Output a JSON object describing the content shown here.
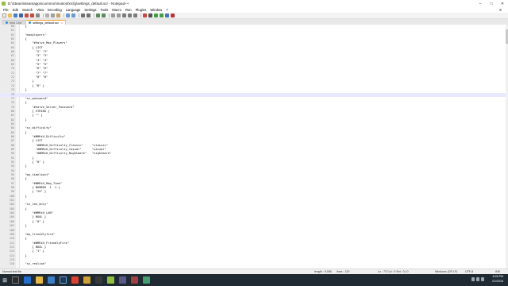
{
  "window": {
    "title": "D:\\Steam\\steamapps\\common\\motionfx\\cfg\\settings_default.scr - Notepad++",
    "minimize": "–",
    "maximize": "□",
    "close": "✕"
  },
  "menu": [
    "File",
    "Edit",
    "Search",
    "View",
    "Encoding",
    "Language",
    "Settings",
    "Tools",
    "Macro",
    "Run",
    "Plugins",
    "Window",
    "?"
  ],
  "menu_close": "X",
  "tabs": [
    {
      "label": "new 1.txt",
      "active": false
    },
    {
      "label": "settings_default.scr",
      "active": true
    }
  ],
  "editor": {
    "current_line": 76,
    "lines": [
      {
        "n": 60,
        "text": "  }"
      },
      {
        "n": 61,
        "text": ""
      },
      {
        "n": 62,
        "text": "  \"maxplayers\""
      },
      {
        "n": 63,
        "text": "  {"
      },
      {
        "n": 64,
        "text": "      \"#Valve_Max_Players\""
      },
      {
        "n": 65,
        "text": "      { LIST"
      },
      {
        "n": 66,
        "text": "        \"2\" \"2\""
      },
      {
        "n": 67,
        "text": "        \"3\" \"3\""
      },
      {
        "n": 68,
        "text": "        \"4\" \"4\""
      },
      {
        "n": 69,
        "text": "        \"5\" \"5\""
      },
      {
        "n": 70,
        "text": "        \"6\" \"6\""
      },
      {
        "n": 71,
        "text": "        \"7\" \"7\""
      },
      {
        "n": 72,
        "text": "        \"8\" \"8\""
      },
      {
        "n": 73,
        "text": "      }"
      },
      {
        "n": 74,
        "text": "      { \"8\" }"
      },
      {
        "n": 75,
        "text": "  }"
      },
      {
        "n": 76,
        "text": ""
      },
      {
        "n": 77,
        "text": "  \"sv_password\""
      },
      {
        "n": 78,
        "text": "  {"
      },
      {
        "n": 79,
        "text": "      \"#Valve_Server_Password\""
      },
      {
        "n": 80,
        "text": "      { STRING }"
      },
      {
        "n": 81,
        "text": "      { \"\" }"
      },
      {
        "n": 82,
        "text": "  }"
      },
      {
        "n": 83,
        "text": ""
      },
      {
        "n": 84,
        "text": "  \"sv_difficulty\""
      },
      {
        "n": 85,
        "text": "  {"
      },
      {
        "n": 86,
        "text": "      \"#NMRiH_Difficulty\""
      },
      {
        "n": 87,
        "text": "      { LIST"
      },
      {
        "n": 88,
        "text": "        \"#NMRiH_Difficulty_Classic\"     \"classic\""
      },
      {
        "n": 89,
        "text": "        \"#NMRiH_Difficulty_Casual\"      \"casual\""
      },
      {
        "n": 90,
        "text": "        \"#NMRiH_Difficulty_Nightmare\"   \"nightmare\""
      },
      {
        "n": 91,
        "text": "      }"
      },
      {
        "n": 92,
        "text": "      { \"0\" }"
      },
      {
        "n": 93,
        "text": "  }"
      },
      {
        "n": 94,
        "text": ""
      },
      {
        "n": 95,
        "text": "  \"mp_timelimit\""
      },
      {
        "n": 96,
        "text": "  {"
      },
      {
        "n": 97,
        "text": "      \"#NMRiH_Map_Time\""
      },
      {
        "n": 98,
        "text": "      { NUMBER -1 -1 }"
      },
      {
        "n": 99,
        "text": "      { \"20\" }"
      },
      {
        "n": 100,
        "text": "  }"
      },
      {
        "n": 101,
        "text": ""
      },
      {
        "n": 102,
        "text": "  \"sv_lan_only\""
      },
      {
        "n": 103,
        "text": "  {"
      },
      {
        "n": 104,
        "text": "      \"#NMRiH_LAN\""
      },
      {
        "n": 105,
        "text": "      { BOOL }"
      },
      {
        "n": 106,
        "text": "      { \"0\" }"
      },
      {
        "n": 107,
        "text": "  }"
      },
      {
        "n": 108,
        "text": ""
      },
      {
        "n": 109,
        "text": "  \"mp_friendlyfire\""
      },
      {
        "n": 110,
        "text": "  {"
      },
      {
        "n": 111,
        "text": "      \"#NMRiH_FriendlyFire\""
      },
      {
        "n": 112,
        "text": "      { BOOL }"
      },
      {
        "n": 113,
        "text": "      { \"1\" }"
      },
      {
        "n": 114,
        "text": "  }"
      },
      {
        "n": 115,
        "text": ""
      },
      {
        "n": 116,
        "text": "  \"sv_realism\""
      }
    ]
  },
  "status": {
    "file_type": "Normal text file",
    "length": "length : 9,056",
    "lines": "lines : 120",
    "position": "Ln : 73   Col : 5   Sel : 0 | 0",
    "eol": "Windows (CR LF)",
    "encoding": "UTF-8",
    "mode": "INS"
  },
  "taskbar": {
    "time": "8:26 PM",
    "date": "2/1/2018"
  },
  "colors": {
    "current_line": "#e8e8ff",
    "taskbar": "#1f2a33",
    "accent": "#f0a030"
  }
}
